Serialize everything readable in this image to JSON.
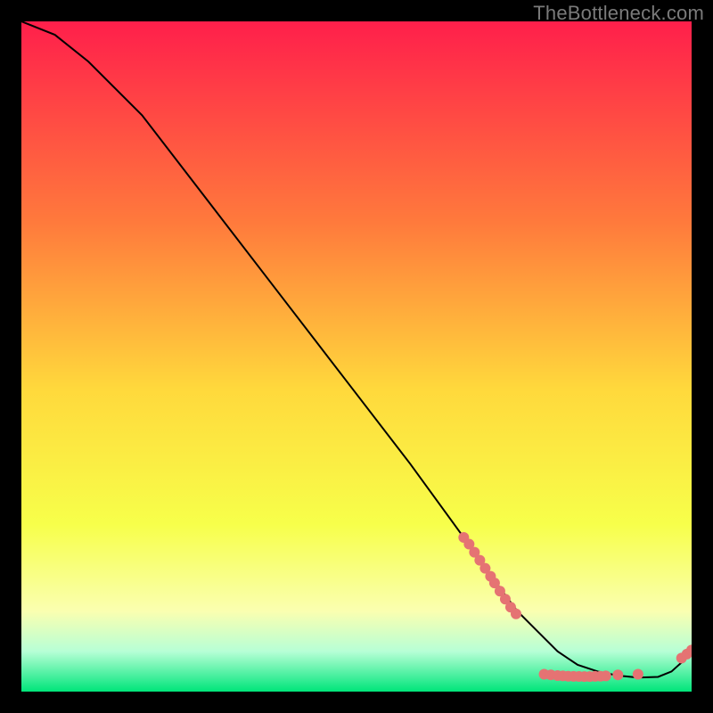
{
  "watermark": "TheBottleneck.com",
  "chart_data": {
    "type": "line",
    "title": "",
    "xlabel": "",
    "ylabel": "",
    "xlim": [
      0,
      100
    ],
    "ylim": [
      0,
      100
    ],
    "background_gradient": {
      "top": "#ff1f4b",
      "mid_upper": "#ff7a3c",
      "mid": "#ffd93c",
      "mid_lower": "#f7ff4a",
      "band_yellow_light": "#faffb0",
      "band_green_light": "#b7ffd6",
      "bottom": "#00e57a"
    },
    "series": [
      {
        "name": "bottleneck-curve",
        "color": "#000000",
        "x": [
          0,
          5,
          10,
          18,
          28,
          38,
          48,
          58,
          66,
          71,
          74,
          77,
          80,
          83,
          86,
          89,
          92,
          95,
          97,
          99,
          100
        ],
        "y": [
          100,
          98,
          94,
          86,
          73,
          60,
          47,
          34,
          23,
          16,
          12,
          9,
          6,
          4,
          3,
          2.4,
          2.1,
          2.2,
          3,
          4.8,
          6
        ]
      }
    ],
    "markers": {
      "name": "highlight-points",
      "color": "#e57373",
      "points": [
        {
          "x": 66,
          "y": 23
        },
        {
          "x": 66.8,
          "y": 22
        },
        {
          "x": 67.6,
          "y": 20.8
        },
        {
          "x": 68.4,
          "y": 19.6
        },
        {
          "x": 69.2,
          "y": 18.4
        },
        {
          "x": 70,
          "y": 17.2
        },
        {
          "x": 70.6,
          "y": 16.2
        },
        {
          "x": 71.4,
          "y": 15
        },
        {
          "x": 72.2,
          "y": 13.8
        },
        {
          "x": 73,
          "y": 12.6
        },
        {
          "x": 73.8,
          "y": 11.6
        },
        {
          "x": 78,
          "y": 2.6
        },
        {
          "x": 79,
          "y": 2.5
        },
        {
          "x": 80,
          "y": 2.4
        },
        {
          "x": 80.8,
          "y": 2.35
        },
        {
          "x": 81.6,
          "y": 2.3
        },
        {
          "x": 82.4,
          "y": 2.28
        },
        {
          "x": 83.2,
          "y": 2.26
        },
        {
          "x": 84,
          "y": 2.25
        },
        {
          "x": 84.8,
          "y": 2.25
        },
        {
          "x": 85.6,
          "y": 2.28
        },
        {
          "x": 86.4,
          "y": 2.3
        },
        {
          "x": 87.2,
          "y": 2.35
        },
        {
          "x": 89,
          "y": 2.5
        },
        {
          "x": 92,
          "y": 2.6
        },
        {
          "x": 98.5,
          "y": 5
        },
        {
          "x": 99.3,
          "y": 5.6
        },
        {
          "x": 100,
          "y": 6.2
        }
      ]
    }
  }
}
